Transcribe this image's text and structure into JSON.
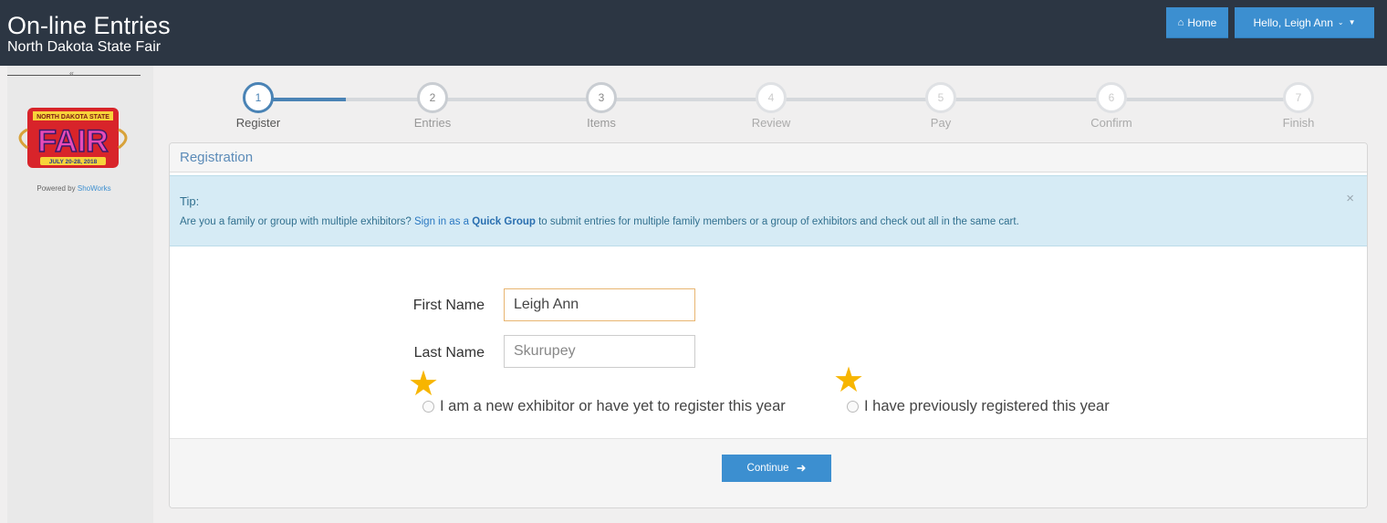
{
  "header": {
    "title": "On-line Entries",
    "subtitle": "North Dakota State Fair",
    "home_label": "Home",
    "user_label": "Hello, Leigh Ann"
  },
  "sidebar": {
    "logo_top_text": "NORTH DAKOTA STATE",
    "logo_main_text": "FAIR",
    "logo_date_text": "JULY 20-28, 2018",
    "powered_prefix": "Powered by",
    "powered_link": "ShoWorks"
  },
  "steps": [
    {
      "number": "1",
      "label": "Register"
    },
    {
      "number": "2",
      "label": "Entries"
    },
    {
      "number": "3",
      "label": "Items"
    },
    {
      "number": "4",
      "label": "Review"
    },
    {
      "number": "5",
      "label": "Pay"
    },
    {
      "number": "6",
      "label": "Confirm"
    },
    {
      "number": "7",
      "label": "Finish"
    }
  ],
  "panel": {
    "heading": "Registration",
    "tip_title": "Tip:",
    "tip_text_1": "Are you a family or group with multiple exhibitors? ",
    "tip_link_1": "Sign in as a ",
    "tip_link_2": "Quick Group",
    "tip_text_2": " to submit entries for multiple family members or a group of exhibitors and check out all in the same cart.",
    "tip_close": "×"
  },
  "form": {
    "first_name_label": "First Name",
    "first_name_value": "Leigh Ann",
    "last_name_label": "Last Name",
    "last_name_value": "Skurupey",
    "radio_new": "I am a new exhibitor or have yet to register this year",
    "radio_previous": "I have previously registered this year"
  },
  "footer": {
    "continue_label": "Continue"
  },
  "colors": {
    "topbar": "#2c3643",
    "accent": "#3c8fd0",
    "star": "#f7b500",
    "tip_bg": "#d6ebf5"
  }
}
